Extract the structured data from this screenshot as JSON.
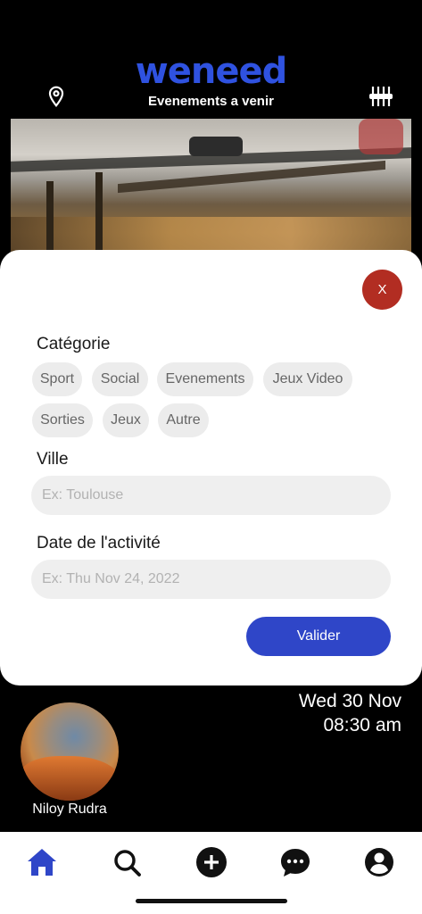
{
  "header": {
    "logo": "weneed",
    "subtitle": "Evenements a venir"
  },
  "filter_sheet": {
    "close_label": "X",
    "category_label": "Catégorie",
    "categories": [
      "Sport",
      "Social",
      "Evenements",
      "Jeux Video",
      "Sorties",
      "Jeux",
      "Autre"
    ],
    "city_label": "Ville",
    "city_placeholder": "Ex: Toulouse",
    "date_label": "Date de l'activité",
    "date_placeholder": "Ex: Thu Nov 24, 2022",
    "submit_label": "Valider"
  },
  "event": {
    "date": "Wed 30 Nov",
    "time": "08:30 am",
    "organizer": "Niloy Rudra"
  },
  "tabs": [
    {
      "name": "home",
      "icon": "home-icon",
      "active": true
    },
    {
      "name": "search",
      "icon": "search-icon",
      "active": false
    },
    {
      "name": "add",
      "icon": "plus-circle-icon",
      "active": false
    },
    {
      "name": "messages",
      "icon": "chat-bubble-icon",
      "active": false
    },
    {
      "name": "profile",
      "icon": "user-circle-icon",
      "active": false
    }
  ],
  "colors": {
    "brand": "#2f52e0",
    "active_tab": "#2f46c8",
    "close_button": "#b22d22",
    "submit_button": "#2f46c8"
  }
}
